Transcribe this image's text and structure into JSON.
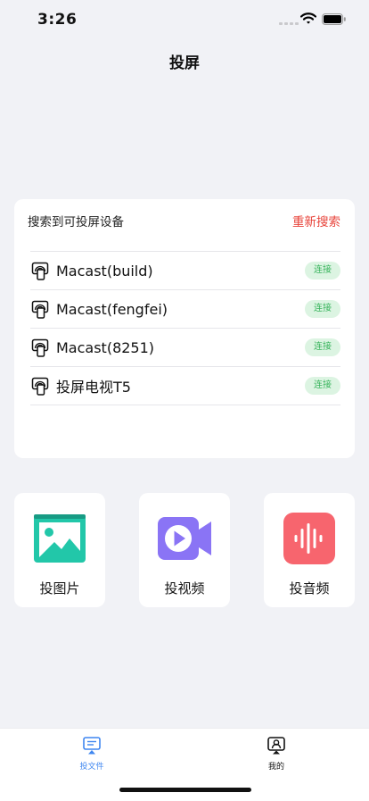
{
  "status_bar": {
    "time": "3:26"
  },
  "nav": {
    "title": "投屏"
  },
  "device_card": {
    "title": "搜索到可投屏设备",
    "rescan_label": "重新搜索",
    "devices": [
      {
        "name": "Macast(build)",
        "action": "连接"
      },
      {
        "name": "Macast(fengfei)",
        "action": "连接"
      },
      {
        "name": "Macast(8251)",
        "action": "连接"
      },
      {
        "name": "投屏电视T5",
        "action": "连接"
      }
    ]
  },
  "cast_options": [
    {
      "label": "投图片",
      "icon": "image-icon",
      "color": "#22c7a9"
    },
    {
      "label": "投视频",
      "icon": "video-icon",
      "color": "#8a74f5"
    },
    {
      "label": "投音频",
      "icon": "audio-icon",
      "color": "#f7656e"
    }
  ],
  "tab_bar": {
    "tabs": [
      {
        "label": "投文件",
        "icon": "cast-file-icon",
        "active": true
      },
      {
        "label": "我的",
        "icon": "profile-icon",
        "active": false
      }
    ],
    "active_color": "#3e86f0"
  },
  "colors": {
    "background": "#f1f2f6",
    "accent_red": "#e8433a",
    "connect_green": "#38b45c"
  }
}
